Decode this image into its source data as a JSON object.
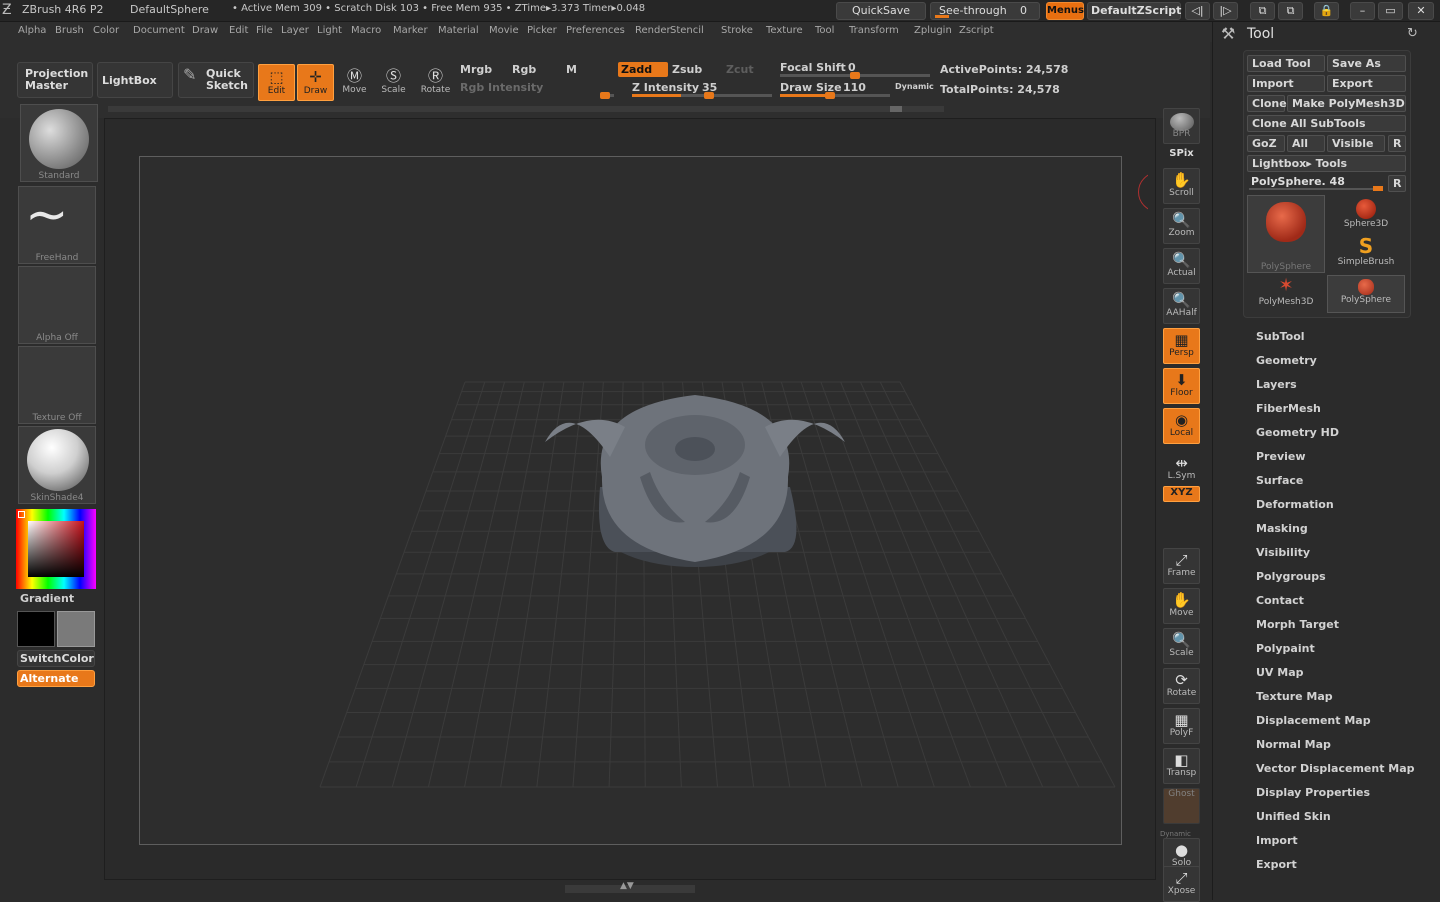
{
  "titlebar": {
    "app": "ZBrush 4R6 P2",
    "doc": "DefaultSphere",
    "stats": "• Active Mem 309 • Scratch Disk 103 • Free Mem 935 • ZTime▸3.373 Timer▸0.048",
    "quicksave": "QuickSave",
    "seethrough": "See-through",
    "seethrough_value": "0",
    "menus": "Menus",
    "zscript": "DefaultZScript"
  },
  "menu": [
    "Alpha",
    "Brush",
    "Color",
    "Document",
    "Draw",
    "Edit",
    "File",
    "Layer",
    "Light",
    "Macro",
    "Marker",
    "Material",
    "Movie",
    "Picker",
    "Preferences",
    "Render",
    "Stencil",
    "Stroke",
    "Texture",
    "Tool",
    "Transform",
    "Zplugin",
    "Zscript"
  ],
  "shelf": {
    "projection_master": "Projection Master",
    "lightbox": "LightBox",
    "quick_sketch": "Quick Sketch",
    "edit": "Edit",
    "draw": "Draw",
    "move": "Move",
    "scale": "Scale",
    "rotate": "Rotate",
    "mrgb": "Mrgb",
    "rgb": "Rgb",
    "m": "M",
    "rgb_intensity": "Rgb Intensity",
    "zadd": "Zadd",
    "zsub": "Zsub",
    "zcut": "Zcut",
    "z_intensity": "Z Intensity",
    "z_intensity_value": "35",
    "focal_shift": "Focal Shift",
    "focal_shift_value": "0",
    "draw_size": "Draw Size",
    "draw_size_value": "110",
    "dynamic": "Dynamic",
    "active_points": "ActivePoints: 24,578",
    "total_points": "TotalPoints: 24,578"
  },
  "left": {
    "brush": "Standard",
    "stroke": "FreeHand",
    "alpha": "Alpha  Off",
    "texture": "Texture  Off",
    "material": "SkinShade4",
    "gradient": "Gradient",
    "switchcolor": "SwitchColor",
    "alternate": "Alternate"
  },
  "right": [
    {
      "name": "bpr",
      "label": "BPR",
      "icon": "sphere",
      "on": false
    },
    {
      "name": "spix",
      "label": "SPix",
      "icon": "",
      "on": false
    },
    {
      "name": "scroll",
      "label": "Scroll",
      "icon": "✋",
      "on": false
    },
    {
      "name": "zoom",
      "label": "Zoom",
      "icon": "🔍",
      "on": false
    },
    {
      "name": "actual",
      "label": "Actual",
      "icon": "🔍",
      "on": false
    },
    {
      "name": "aahalf",
      "label": "AAHalf",
      "icon": "🔍",
      "on": false
    },
    {
      "name": "persp",
      "label": "Persp",
      "icon": "▦",
      "on": true
    },
    {
      "name": "floor",
      "label": "Floor",
      "icon": "⬇",
      "on": true
    },
    {
      "name": "local",
      "label": "Local",
      "icon": "◉",
      "on": true
    },
    {
      "name": "lsym",
      "label": "L.Sym",
      "icon": "⇹",
      "on": false
    },
    {
      "name": "xyz",
      "label": "XYZ",
      "icon": "",
      "on": true
    },
    {
      "name": "frame",
      "label": "Frame",
      "icon": "⤢",
      "on": false
    },
    {
      "name": "move",
      "label": "Move",
      "icon": "✋",
      "on": false
    },
    {
      "name": "scale",
      "label": "Scale",
      "icon": "🔍",
      "on": false
    },
    {
      "name": "rotate",
      "label": "Rotate",
      "icon": "⟳",
      "on": false
    },
    {
      "name": "polyf",
      "label": "PolyF",
      "icon": "▦",
      "on": false
    },
    {
      "name": "transp",
      "label": "Transp",
      "icon": "◧",
      "on": false
    },
    {
      "name": "ghost",
      "label": "Ghost",
      "icon": "",
      "on": false
    },
    {
      "name": "solo",
      "label": "Solo",
      "icon": "●",
      "on": false
    },
    {
      "name": "xpose",
      "label": "Xpose",
      "icon": "⤢",
      "on": false
    }
  ],
  "dynamic_label": "Dynamic",
  "tool": {
    "title": "Tool",
    "load": "Load Tool",
    "saveas": "Save As",
    "import": "Import",
    "export": "Export",
    "clone": "Clone",
    "make": "Make PolyMesh3D",
    "cloneall": "Clone  All  SubTools",
    "goz": "GoZ",
    "all": "All",
    "visible": "Visible",
    "r": "R",
    "lightbox_tools": "Lightbox▸ Tools",
    "current": "PolySphere. 48",
    "thumbs": [
      "PolySphere",
      "Sphere3D",
      "SimpleBrush",
      "PolyMesh3D",
      "PolySphere"
    ],
    "sections": [
      "SubTool",
      "Geometry",
      "Layers",
      "FiberMesh",
      "Geometry  HD",
      "Preview",
      "Surface",
      "Deformation",
      "Masking",
      "Visibility",
      "Polygroups",
      "Contact",
      "Morph  Target",
      "Polypaint",
      "UV  Map",
      "Texture  Map",
      "Displacement  Map",
      "Normal  Map",
      "Vector  Displacement  Map",
      "Display  Properties",
      "Unified  Skin",
      "Import",
      "Export"
    ]
  },
  "colors": {
    "accent": "#e8781a",
    "panel": "#2b2b2b"
  }
}
